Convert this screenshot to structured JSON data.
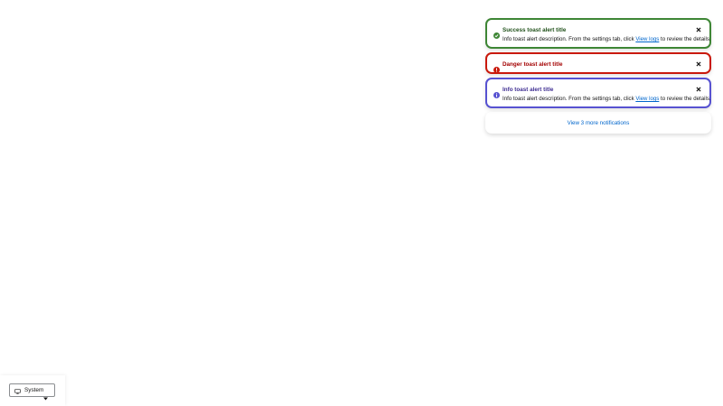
{
  "toasts": [
    {
      "variant": "success",
      "icon": "check-circle-icon",
      "title": "Success toast alert title",
      "description": {
        "before": "Info toast alert description. From the settings tab, click ",
        "link": "View logs",
        "after": " to review the details."
      }
    },
    {
      "variant": "danger",
      "icon": "exclamation-circle-icon",
      "title": "Danger toast alert title"
    },
    {
      "variant": "info",
      "icon": "info-circle-icon",
      "title": "Info toast alert title",
      "description": {
        "before": "Info toast alert description. From the settings tab, click ",
        "link": "View logs",
        "after": " to review the details."
      }
    }
  ],
  "overflow_link": "View 3 more notifications",
  "theme_selector": {
    "icon": "monitor-icon",
    "value": "System"
  },
  "colors": {
    "success": "#3e8635",
    "danger": "#c9190b",
    "info": "#5752d1",
    "link": "#0066cc"
  }
}
